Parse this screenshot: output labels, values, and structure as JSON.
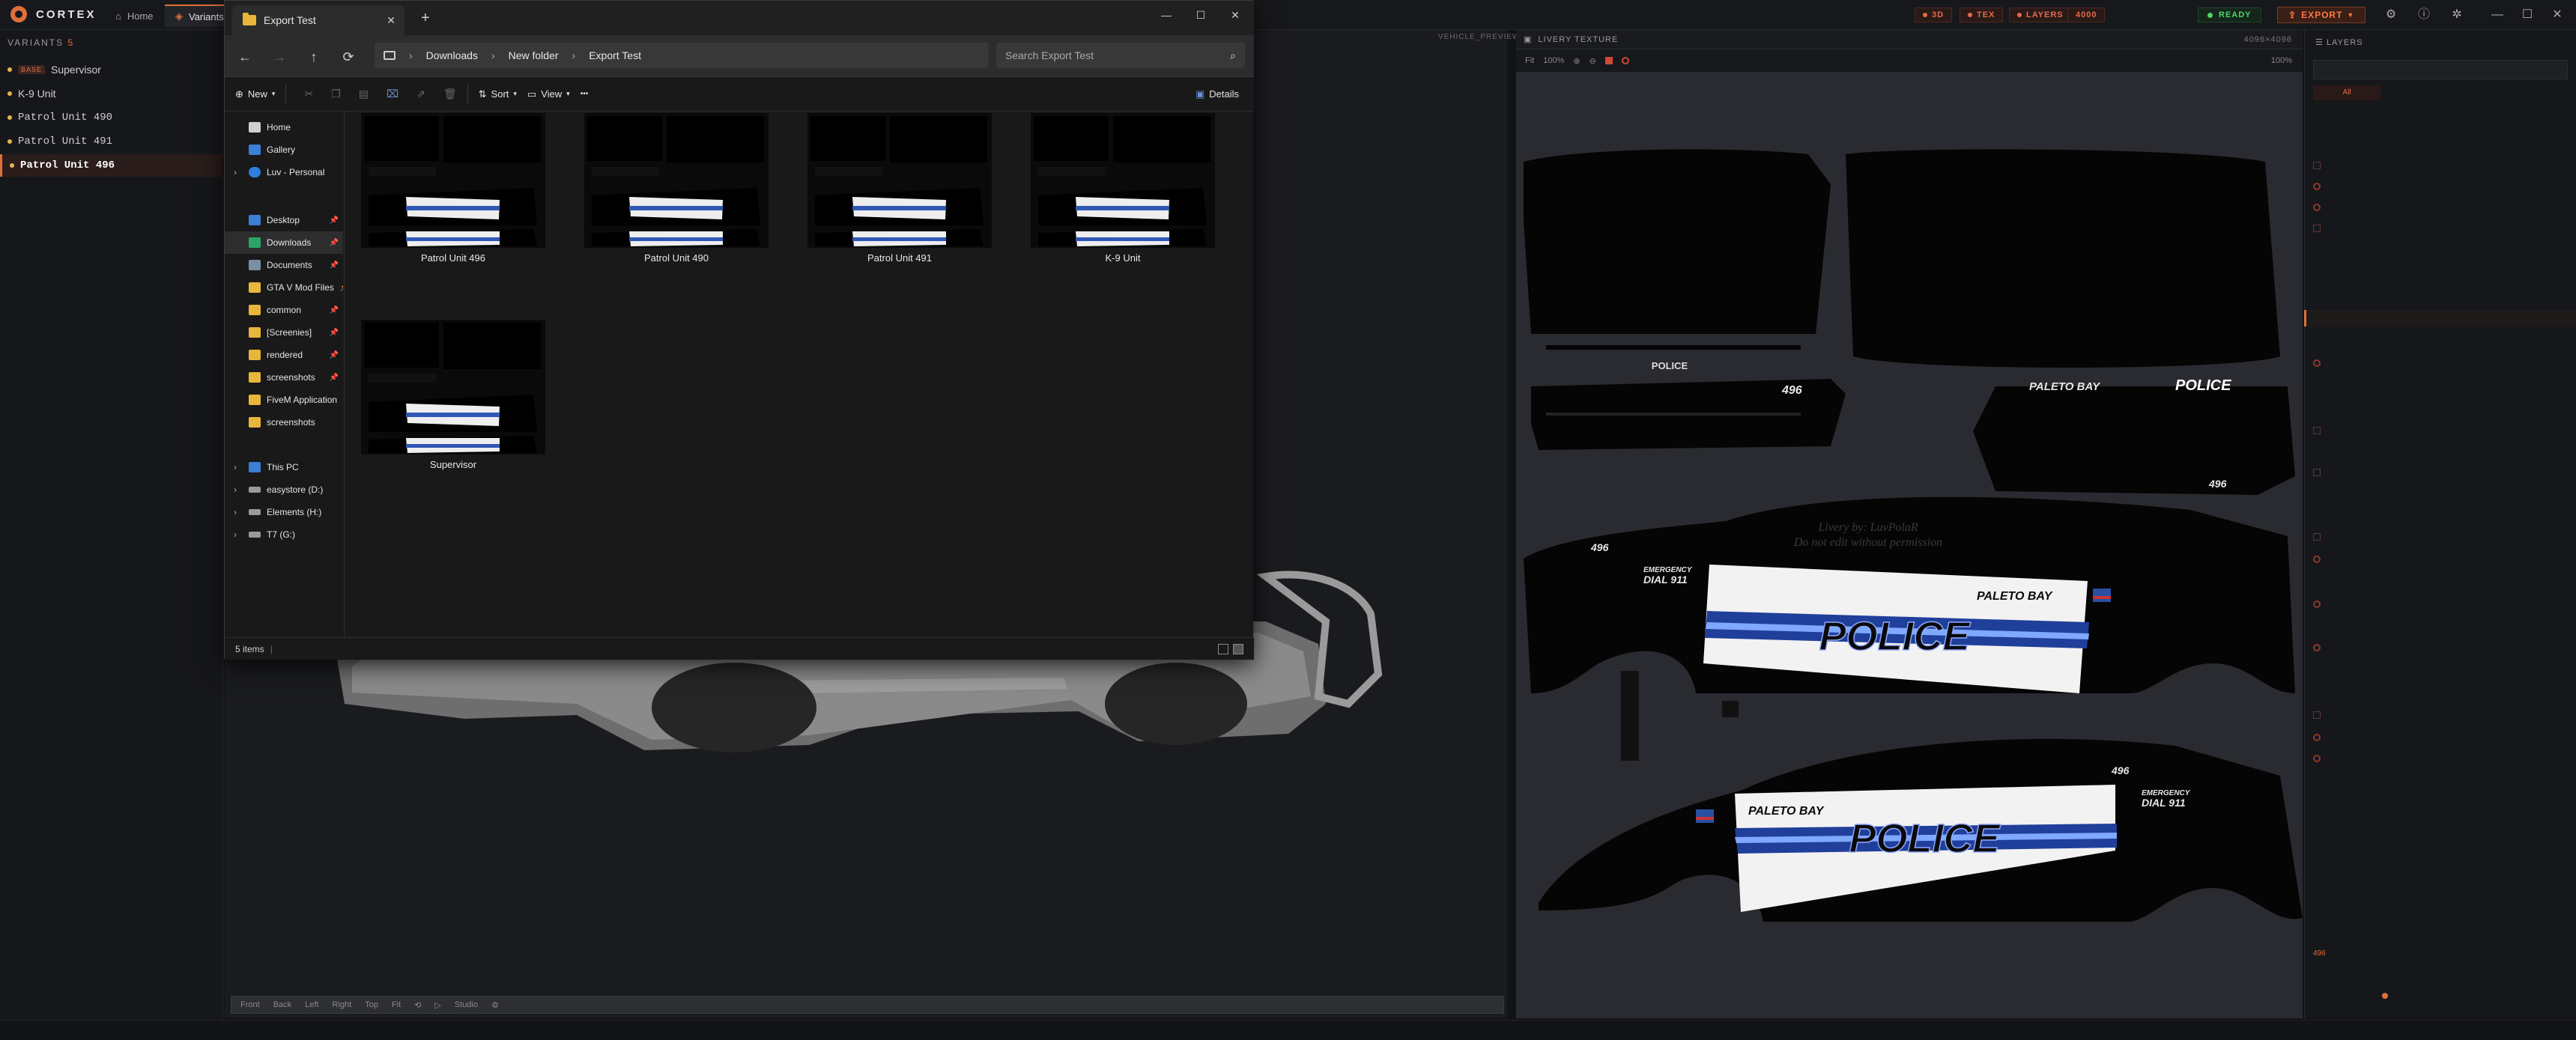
{
  "app": {
    "name": "CORTEX",
    "tabs": [
      {
        "label": "Home"
      },
      {
        "label": "Variants"
      }
    ],
    "top_pills": [
      {
        "label": "3D"
      },
      {
        "label": "TEX"
      },
      {
        "label": "LAYERS"
      },
      {
        "label": "4000"
      }
    ],
    "status": "READY",
    "export_label": "EXPORT",
    "colors": {
      "accent": "#e0703a",
      "ready": "#4fd36a",
      "panel": "#16171a"
    }
  },
  "variants": {
    "header": "VARIANTS",
    "count": "5",
    "base_badge": "BASE",
    "items": [
      {
        "label": "Supervisor"
      },
      {
        "label": "K-9 Unit"
      },
      {
        "label": "Patrol Unit 490"
      },
      {
        "label": "Patrol Unit 491"
      },
      {
        "label": "Patrol Unit 496"
      }
    ]
  },
  "viewport": {
    "header": "VEHICLE_PREVIEW",
    "bottom_tools": [
      "Front",
      "Back",
      "Left",
      "Right",
      "Top",
      "Fit",
      "⟲",
      "▷",
      "Studio",
      "⚙"
    ]
  },
  "texture": {
    "header": "LIVERY TEXTURE",
    "header_right": "4096×4096",
    "tools": [
      "Fit",
      "100%",
      "⊕",
      "⊖"
    ],
    "zoom": "100%",
    "livery": {
      "police": "POLICE",
      "paleto": "PALETO BAY",
      "unit": "496",
      "emergency_1": "EMERGENCY",
      "emergency_2": "DIAL 911",
      "credit_1": "Livery by: LuvPolaR",
      "credit_2": "Do not edit without permission"
    }
  },
  "layers": {
    "header": "LAYERS",
    "all_label": "All",
    "footer": "496"
  },
  "explorer": {
    "tab_title": "Export Test",
    "breadcrumb": [
      "Downloads",
      "New folder",
      "Export Test"
    ],
    "search_placeholder": "Search Export Test",
    "cmd": {
      "new": "New",
      "sort": "Sort",
      "view": "View",
      "more": "•••",
      "details": "Details"
    },
    "nav_top": [
      {
        "label": "Home",
        "icon": "home-icon"
      },
      {
        "label": "Gallery",
        "icon": "gallery-icon"
      },
      {
        "label": "Luv - Personal",
        "icon": "cloud-icon"
      }
    ],
    "nav_quick": [
      {
        "label": "Desktop",
        "color": "#3b7fd6"
      },
      {
        "label": "Downloads",
        "color": "#2aa56a"
      },
      {
        "label": "Documents",
        "color": "#7a8ea6"
      },
      {
        "label": "GTA V Mod Files",
        "color": "#e9b63c"
      },
      {
        "label": "common",
        "color": "#e9b63c"
      },
      {
        "label": "[Screenies]",
        "color": "#e9b63c"
      },
      {
        "label": "rendered",
        "color": "#e9b63c"
      },
      {
        "label": "screenshots",
        "color": "#e9b63c"
      },
      {
        "label": "FiveM Application",
        "color": "#e9b63c"
      },
      {
        "label": "screenshots",
        "color": "#e9b63c"
      }
    ],
    "nav_drives": [
      {
        "label": "This PC"
      },
      {
        "label": "easystore (D:)"
      },
      {
        "label": "Elements (H:)"
      },
      {
        "label": "T7 (G:)"
      }
    ],
    "files": [
      {
        "name": "Patrol Unit 496"
      },
      {
        "name": "Patrol Unit 490"
      },
      {
        "name": "Patrol Unit 491"
      },
      {
        "name": "K-9 Unit"
      },
      {
        "name": "Supervisor"
      }
    ],
    "status": "5 items"
  }
}
